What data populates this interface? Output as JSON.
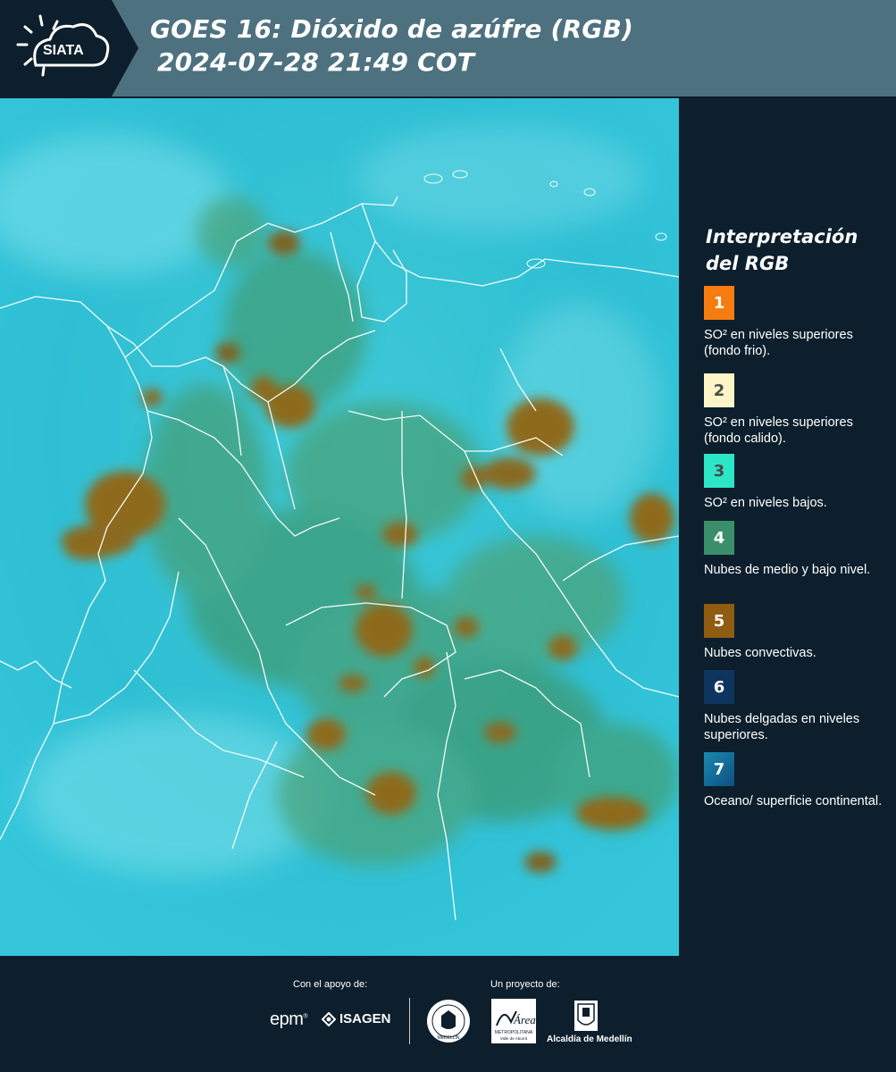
{
  "header": {
    "logo_text": "SIATA",
    "title_line1": "GOES 16: Dióxido de azúfre (RGB)",
    "title_line2": "2024-07-28 21:49 COT"
  },
  "legend": {
    "title": "Interpretación del RGB",
    "items": [
      {
        "number": "1",
        "color": "#f57d0f",
        "description": "SO² en niveles superiores (fondo frio)."
      },
      {
        "number": "2",
        "color": "#fbf5c8",
        "description": "SO² en niveles superiores (fondo calido)."
      },
      {
        "number": "3",
        "color": "#2de6c8",
        "description": "SO² en niveles bajos."
      },
      {
        "number": "4",
        "color": "#3a8f6a",
        "description": "Nubes de medio y bajo nivel."
      },
      {
        "number": "5",
        "color": "#8f5c12",
        "description": "Nubes convectivas."
      },
      {
        "number": "6",
        "color": "#0e3560",
        "description": "Nubes delgadas en niveles superiores."
      },
      {
        "number": "7",
        "color": "#1a8ab0",
        "description": "Oceano/ superficie continental."
      }
    ]
  },
  "footer": {
    "support_label": "Con el apoyo de:",
    "project_label": "Un proyecto de:",
    "sponsor_1": "epm",
    "sponsor_2": "ISAGEN",
    "seal_text": "MEDELLÍN",
    "area_text": "Área",
    "area_sub": "METROPOLITANA",
    "area_sub2": "Valle de Aburrá",
    "alcaldia": "Alcaldía de Medellín"
  },
  "colors": {
    "header_bg": "#4e7180",
    "panel_bg": "#0d1f2c",
    "ocean_cyan": "#2ec8d8",
    "convective_brown": "#8b6a1c",
    "low_cloud_green": "#3c9a6a"
  }
}
